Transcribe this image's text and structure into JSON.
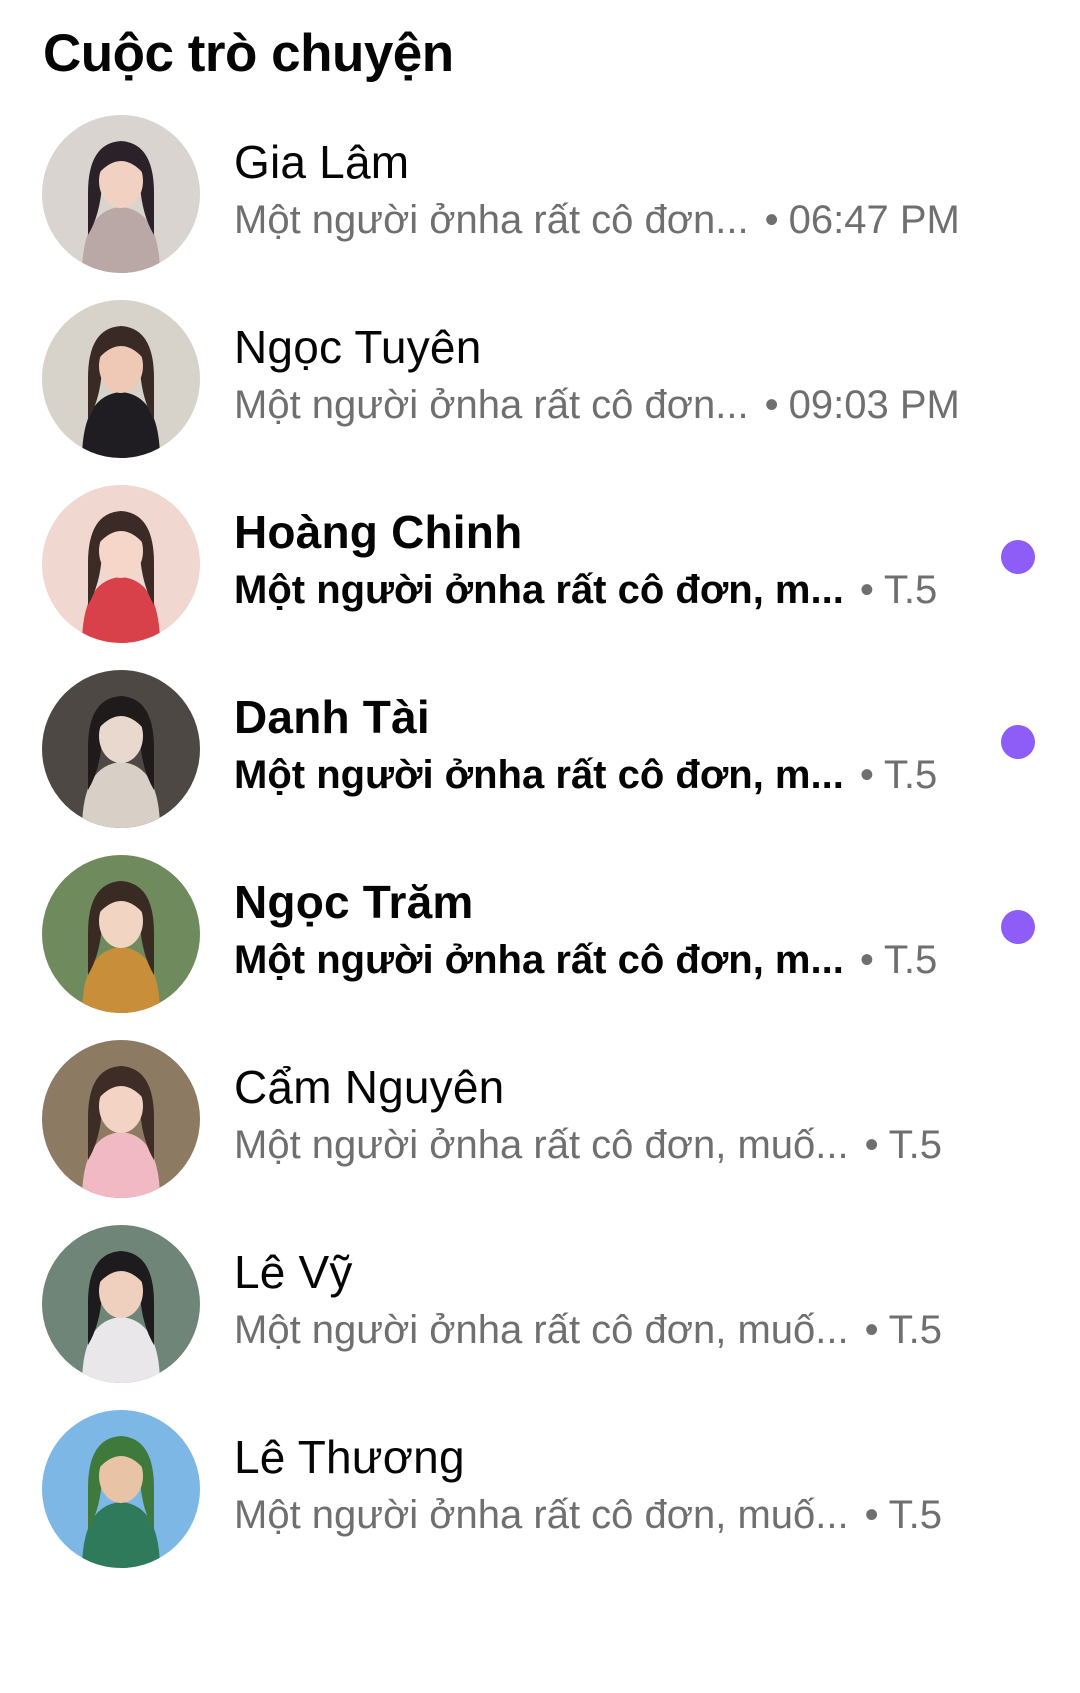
{
  "header": {
    "title": "Cuộc trò chuyện"
  },
  "colors": {
    "unread_dot": "#8e5cf7",
    "muted_text": "#6f6f6f",
    "primary_text": "#050505"
  },
  "conversations": [
    {
      "name": "Gia Lâm",
      "preview": "Một người ởnha rất cô đơn...",
      "separator": "•",
      "time": "06:47 PM",
      "unread": false,
      "avatar_palette": [
        "#d9d4cf",
        "#2a2228",
        "#f1d2c2",
        "#b9a8a6"
      ]
    },
    {
      "name": "Ngọc Tuyên",
      "preview": "Một người ởnha rất cô đơn...",
      "separator": "•",
      "time": "09:03 PM",
      "unread": false,
      "avatar_palette": [
        "#d8d3ca",
        "#3a2a26",
        "#efc9b5",
        "#1f1d22"
      ]
    },
    {
      "name": "Hoàng Chinh",
      "preview": "Một người ởnha rất cô đơn, m...",
      "separator": "•",
      "time": "T.5",
      "unread": true,
      "avatar_palette": [
        "#f0d7cf",
        "#3b2a25",
        "#f6d6c8",
        "#d9414a"
      ]
    },
    {
      "name": "Danh Tài",
      "preview": "Một người ởnha rất cô đơn, m...",
      "separator": "•",
      "time": "T.5",
      "unread": true,
      "avatar_palette": [
        "#4d4843",
        "#1e1b1a",
        "#e8d8cd",
        "#d8cfc6"
      ]
    },
    {
      "name": "Ngọc Trăm",
      "preview": "Một người ởnha rất cô đơn, m...",
      "separator": "•",
      "time": "T.5",
      "unread": true,
      "avatar_palette": [
        "#6f8a5c",
        "#3a2a24",
        "#f2d4c3",
        "#c88e3a"
      ]
    },
    {
      "name": "Cẩm Nguyên",
      "preview": "Một người ởnha rất cô đơn, muố...",
      "separator": "•",
      "time": "T.5",
      "unread": false,
      "avatar_palette": [
        "#8d7a63",
        "#3e2c26",
        "#f3d3c4",
        "#f0b9c3"
      ]
    },
    {
      "name": "Lê Vỹ",
      "preview": "Một người ởnha rất cô đơn, muố...",
      "separator": "•",
      "time": "T.5",
      "unread": false,
      "avatar_palette": [
        "#6f8578",
        "#1d1b1d",
        "#efcfbd",
        "#e9e7ea"
      ]
    },
    {
      "name": "Lê Thương",
      "preview": "Một người ởnha rất cô đơn, muố...",
      "separator": "•",
      "time": "T.5",
      "unread": false,
      "avatar_palette": [
        "#7db7e6",
        "#3f7a3c",
        "#e9c3a6",
        "#2f7a5a"
      ]
    }
  ]
}
